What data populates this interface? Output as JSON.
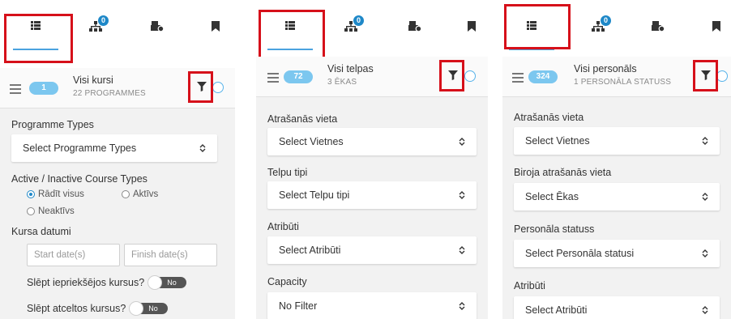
{
  "panels": [
    {
      "header": {
        "count": "1",
        "title": "Visi kursi",
        "subtitle": "22 PROGRAMMES"
      },
      "tab_badge": "0",
      "programme_types": {
        "label": "Programme Types",
        "select": "Select Programme Types"
      },
      "course_types": {
        "label": "Active / Inactive Course Types",
        "options": [
          "Rādīt visus",
          "Aktīvs",
          "Neaktīvs"
        ],
        "selected": "Rādīt visus"
      },
      "dates": {
        "label": "Kursa datumi",
        "start_placeholder": "Start date(s)",
        "finish_placeholder": "Finish date(s)"
      },
      "hide_previous": {
        "label": "Slēpt iepriekšējos kursus?",
        "toggle": "No"
      },
      "hide_cancelled": {
        "label": "Slēpt atceltos kursus?",
        "toggle": "No"
      }
    },
    {
      "header": {
        "count": "72",
        "title": "Visi telpas",
        "subtitle": "3 ĒKAS"
      },
      "tab_badge": "0",
      "fields": [
        {
          "label": "Atrašanās vieta",
          "select": "Select Vietnes"
        },
        {
          "label": "Telpu tipi",
          "select": "Select Telpu tipi"
        },
        {
          "label": "Atribūti",
          "select": "Select Atribūti"
        },
        {
          "label": "Capacity",
          "select": "No Filter"
        }
      ]
    },
    {
      "header": {
        "count": "324",
        "title": "Visi personāls",
        "subtitle": "1 PERSONĀLA STATUSS"
      },
      "tab_badge": "0",
      "fields": [
        {
          "label": "Atrašanās vieta",
          "select": "Select Vietnes"
        },
        {
          "label": "Biroja atrašanās vieta",
          "select": "Select Ēkas"
        },
        {
          "label": "Personāla statuss",
          "select": "Select Personāla statusi"
        },
        {
          "label": "Atribūti",
          "select": "Select Atribūti"
        }
      ]
    }
  ],
  "colors": {
    "accent": "#1e88c8",
    "count_pill": "#7cc7ef",
    "highlight_box": "#d6101a",
    "panel_bg": "#f2f2f2"
  },
  "icons": [
    "list-icon",
    "hierarchy-icon",
    "building-settings-icon",
    "bookmark-icon",
    "filter-icon",
    "hamburger-icon",
    "caret-updown-icon"
  ]
}
